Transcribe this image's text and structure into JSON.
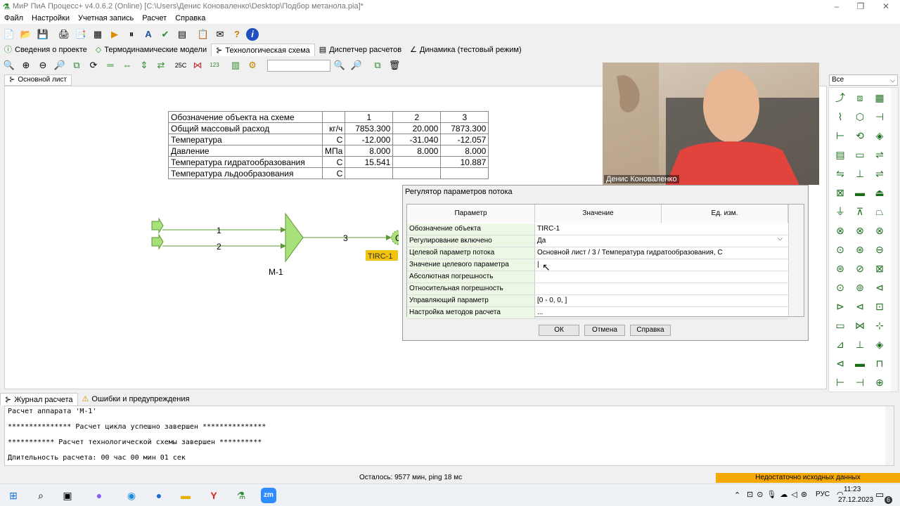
{
  "window": {
    "title": "МиР ПиА Процесс+ v4.0.6.2 (Online) [C:\\Users\\Денис Коноваленко\\Desktop\\Подбор метанола.pia]*",
    "controls": [
      "–",
      "❐",
      "✕"
    ]
  },
  "menu": [
    "Файл",
    "Настройки",
    "Учетная запись",
    "Расчет",
    "Справка"
  ],
  "toolbar1": [
    "📄",
    "📂",
    "💾",
    "🖨",
    "📑",
    "▦",
    "▶",
    "⏸",
    "A",
    "✔",
    "▤",
    "📋",
    "✉",
    "?",
    "i"
  ],
  "toolbar2": {
    "icons_left": [
      "🔍",
      "⊕",
      "⊖",
      "🔎",
      "⧉",
      "⟳",
      "═",
      "⇔",
      "⇕",
      "⇄",
      "25C",
      "⋈",
      "123",
      "▥",
      "⚙"
    ],
    "search_value": "",
    "icons_right": [
      "🔍",
      "🔎",
      "⧉",
      "🗑"
    ]
  },
  "main_tabs": [
    {
      "label": "Сведения о проекте",
      "icon": "info-icon"
    },
    {
      "label": "Термодинамические модели",
      "icon": "model-icon"
    },
    {
      "label": "Технологическая схема",
      "icon": "scheme-icon",
      "active": true
    },
    {
      "label": "Диспетчер расчетов",
      "icon": "dispatcher-icon"
    },
    {
      "label": "Динамика (тестовый режим)",
      "icon": "dynamics-icon"
    }
  ],
  "sheet_tab": "Основной лист",
  "stream_table": {
    "rows": [
      [
        "Обозначение объекта на схеме",
        "",
        "1",
        "2",
        "3"
      ],
      [
        "Общий массовый расход",
        "кг/ч",
        "7853.300",
        "20.000",
        "7873.300"
      ],
      [
        "Температура",
        "С",
        "-12.000",
        "-31.040",
        "-12.057"
      ],
      [
        "Давление",
        "МПа",
        "8.000",
        "8.000",
        "8.000"
      ],
      [
        "Температура гидратообразования",
        "С",
        "15.541",
        "",
        "10.887"
      ],
      [
        "Температура льдообразования",
        "С",
        "",
        "",
        ""
      ]
    ]
  },
  "diagram": {
    "stream1": "1",
    "stream2": "2",
    "stream3": "3",
    "mixer_label": "М-1",
    "controller_tag": "TIRC-1",
    "controller_symbol": "C"
  },
  "webcam": {
    "name": "Денис Коноваленко"
  },
  "dialog": {
    "title": "Регулятор параметров потока",
    "headers": [
      "Параметр",
      "Значение",
      "Ед. изм."
    ],
    "rows": [
      {
        "param": "Обозначение объекта",
        "value": "TIRC-1"
      },
      {
        "param": "Регулирование включено",
        "value": "Да"
      },
      {
        "param": "Целевой параметр потока",
        "value": "Основной лист / 3 / Температура гидратообразования, С"
      },
      {
        "param": "Значение целевого параметра",
        "value": "|"
      },
      {
        "param": "Абсолютная погрешность",
        "value": ""
      },
      {
        "param": "Относительная погрешность",
        "value": ""
      },
      {
        "param": "Управляющий параметр",
        "value": "[0 - 0, 0, ]"
      },
      {
        "param": "Настройка методов расчета",
        "value": "..."
      }
    ],
    "ok": "ОК",
    "cancel": "Отмена",
    "help": "Справка"
  },
  "palette": {
    "filter": "Все"
  },
  "log_tabs": [
    {
      "label": "Журнал расчета",
      "active": true
    },
    {
      "label": "Ошибки и предупреждения"
    }
  ],
  "log": [
    "Расчет аппарата 'М-1'",
    "*************** Расчет цикла успешно завершен ***************",
    "*********** Расчет технологической схемы завершен **********",
    "Длительность расчета: 00 час 00 мин 01 сек"
  ],
  "status": {
    "center": "Осталось: 9577 мин, ping 18 мс",
    "warning": "Недостаточно исходных данных",
    "warning_color": "#f5a800"
  },
  "taskbar": {
    "lang": "РУС",
    "time": "11:23",
    "date": "27.12.2023",
    "notifications": "6"
  }
}
